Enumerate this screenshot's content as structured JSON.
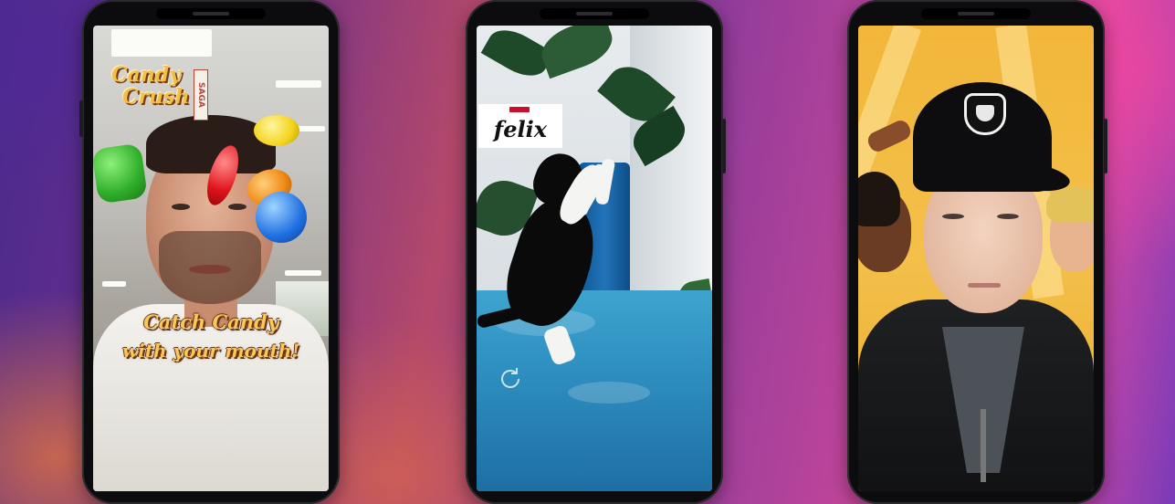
{
  "phones": [
    {
      "name": "candy-crush-filter",
      "logo": {
        "line1": "Candy",
        "line2": "Crush",
        "side": "SAGA"
      },
      "caption": {
        "line1": "Catch Candy",
        "line2": "with your mouth!"
      }
    },
    {
      "name": "felix-cat-filter",
      "brand": "felix",
      "icons": [
        "refresh-icon"
      ]
    },
    {
      "name": "cartoon-crowd-filter"
    }
  ],
  "colors": {
    "candy_text": "#f6c95a",
    "felix_floor": "#2e8fc0",
    "crowd_background": "#f2b63a"
  }
}
